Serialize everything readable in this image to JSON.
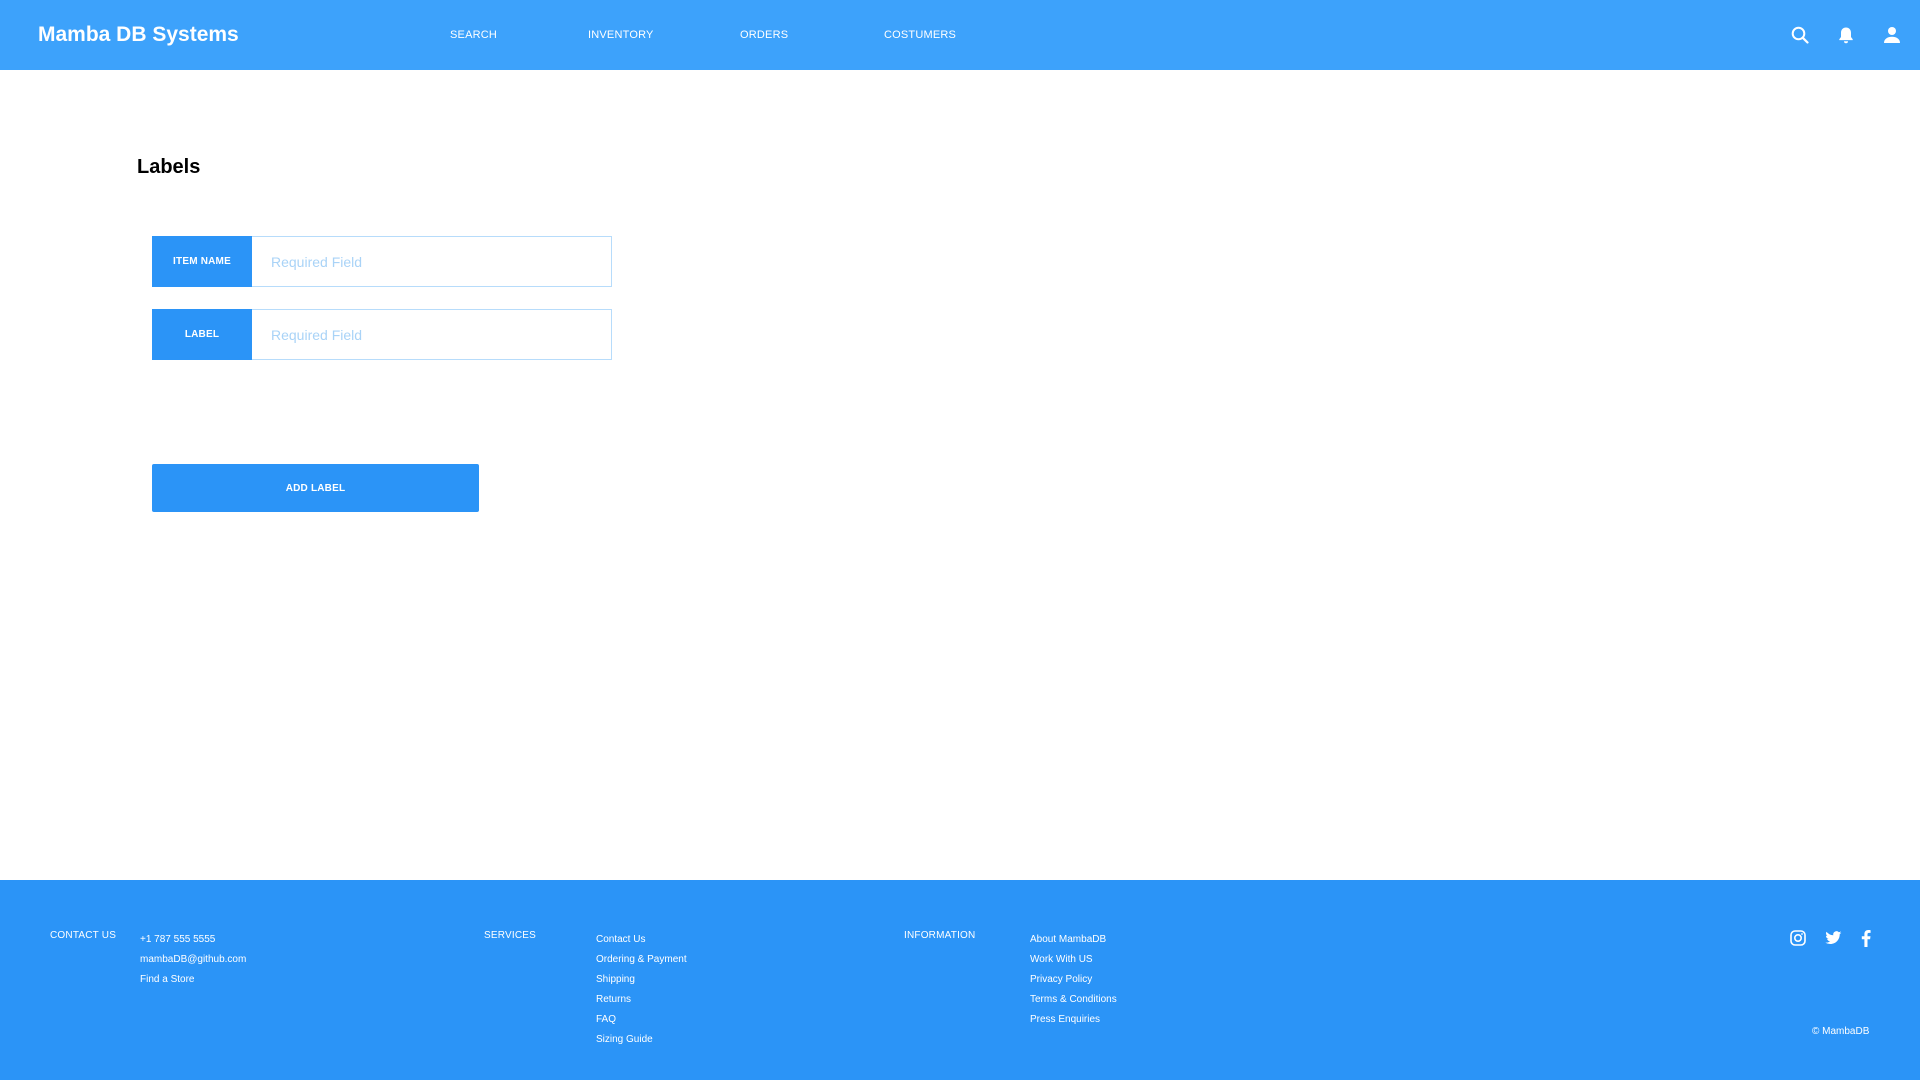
{
  "header": {
    "brand": "Mamba DB Systems",
    "nav": [
      "SEARCH",
      "INVENTORY",
      "ORDERS",
      "COSTUMERS"
    ],
    "icons": [
      "search-icon",
      "bell-icon",
      "user-icon"
    ],
    "background": "#3da2fb"
  },
  "main": {
    "title": "Labels",
    "fields": [
      {
        "tag": "ITEM NAME",
        "placeholder": "Required Field",
        "value": ""
      },
      {
        "tag": "LABEL",
        "placeholder": "Required Field",
        "value": ""
      }
    ],
    "add_button": "ADD LABEL",
    "accent": "#2b94f7"
  },
  "footer": {
    "contact": {
      "heading": "CONTACT US",
      "items": [
        "+1 787 555 5555",
        "mambaDB@github.com",
        "Find a Store"
      ]
    },
    "services": {
      "heading": "SERVICES",
      "items": [
        "Contact Us",
        "Ordering & Payment",
        "Shipping",
        "Returns",
        "FAQ",
        "Sizing Guide"
      ]
    },
    "information": {
      "heading": "INFORMATION",
      "items": [
        "About MambaDB",
        "Work With US",
        "Privacy Policy",
        "Terms & Conditions",
        "Press Enquiries"
      ]
    },
    "social": [
      "instagram-icon",
      "twitter-icon",
      "facebook-icon"
    ],
    "copyright": "© MambaDB",
    "background": "#2b94f7"
  }
}
